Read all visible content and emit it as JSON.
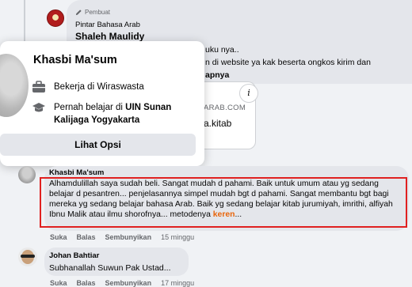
{
  "creator": {
    "badge": "Pembuat",
    "page_name": "Pintar Bahasa Arab",
    "author": "Shaleh Maulidy"
  },
  "post": {
    "lines": [
      "uku nya..",
      "n di website ya kak beserta ongkos kirim dan",
      "apnya"
    ],
    "link_domain": "ARAB.COM",
    "link_title": "a.kitab",
    "info_icon": "info-icon"
  },
  "hover_card": {
    "name": "Khasbi Ma'sum",
    "work": "Bekerja di Wiraswasta",
    "study_prefix": "Pernah belajar di ",
    "study_school": "UIN Sunan Kalijaga Yogyakarta",
    "button": "Lihat Opsi"
  },
  "comment1": {
    "author": "Khasbi Ma'sum",
    "text": "Alhamdulillah saya sudah beli. Sangat mudah d pahami. Baik untuk umum atau yg sedang belajar d pesantren... penjelasannya simpel mudah bgt d pahami. Sangat membantu bgt bagi mereka yg sedang belajar bahasa Arab. Baik yg sedang belajar kitab jurumiyah, imrithi, alfiyah Ibnu Malik atau ilmu shorofnya... metodenya ",
    "highlight": "keren",
    "trailing": "...",
    "actions": {
      "like": "Suka",
      "reply": "Balas",
      "hide": "Sembunyikan",
      "time": "15 minggu"
    }
  },
  "comment2": {
    "author": "Johan Bahtiar",
    "text": "Subhanallah Suwun Pak Ustad...",
    "actions": {
      "like": "Suka",
      "reply": "Balas",
      "hide": "Sembunyikan",
      "time": "17 minggu"
    }
  },
  "colors": {
    "bubble": "#e4e6eb",
    "highlight_border": "#e02020",
    "keyword": "#e8650c",
    "meta_text": "#65676b"
  }
}
